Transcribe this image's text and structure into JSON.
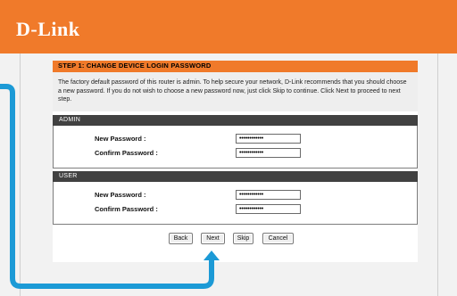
{
  "header": {
    "logo_text": "D-Link"
  },
  "step": {
    "title": "STEP 1: CHANGE DEVICE LOGIN PASSWORD",
    "description": "The factory default password of this router is admin. To help secure your network, D-Link recommends that you should choose a new password. If you do not wish to choose a new password now, just click Skip to continue. Click Next to proceed to next step."
  },
  "admin": {
    "title": "ADMIN",
    "new_password_label": "New Password :",
    "new_password_value": "••••••••••••",
    "confirm_password_label": "Confirm Password :",
    "confirm_password_value": "••••••••••••"
  },
  "user": {
    "title": "USER",
    "new_password_label": "New Password :",
    "new_password_value": "••••••••••••",
    "confirm_password_label": "Confirm Password :",
    "confirm_password_value": "••••••••••••"
  },
  "buttons": {
    "back": "Back",
    "next": "Next",
    "skip": "Skip",
    "cancel": "Cancel"
  },
  "colors": {
    "brand_orange": "#f07a2a",
    "section_bar": "#414141",
    "annotation_blue": "#1c9ad6"
  },
  "annotation": {
    "icon": "arrow-up-icon",
    "points_to": "Next"
  }
}
